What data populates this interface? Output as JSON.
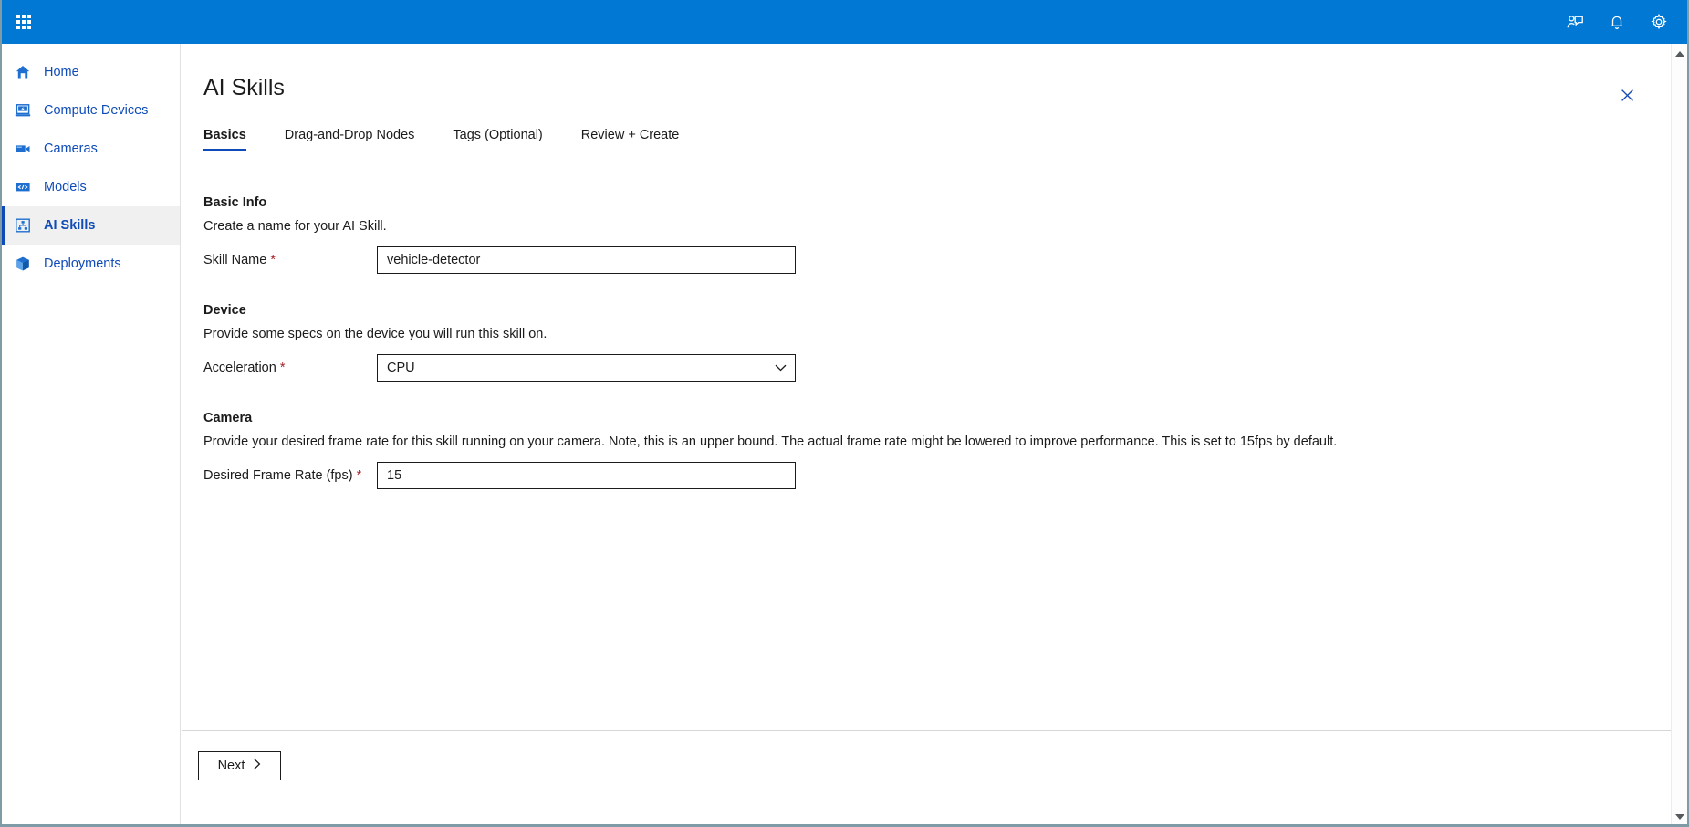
{
  "topbar": {
    "waffle_label": "app-launcher",
    "icons": [
      {
        "name": "feedback-icon",
        "title": "Feedback"
      },
      {
        "name": "notification-bell-icon",
        "title": "Notifications"
      },
      {
        "name": "settings-gear-icon",
        "title": "Settings"
      }
    ],
    "accent_color": "#0078d4"
  },
  "sidebar": {
    "items": [
      {
        "label": "Home",
        "icon": "home-icon",
        "active": false
      },
      {
        "label": "Compute Devices",
        "icon": "laptop-icon",
        "active": false
      },
      {
        "label": "Cameras",
        "icon": "video-camera-icon",
        "active": false
      },
      {
        "label": "Models",
        "icon": "code-brackets-icon",
        "active": false
      },
      {
        "label": "AI Skills",
        "icon": "skill-nodes-icon",
        "active": true
      },
      {
        "label": "Deployments",
        "icon": "cube-icon",
        "active": false
      }
    ],
    "link_color": "#0f4bb8",
    "active_bg": "#f0f0f0"
  },
  "panel": {
    "title": "AI Skills",
    "close_label": "Close",
    "tabs": [
      {
        "label": "Basics",
        "active": true
      },
      {
        "label": "Drag-and-Drop Nodes",
        "active": false
      },
      {
        "label": "Tags (Optional)",
        "active": false
      },
      {
        "label": "Review + Create",
        "active": false
      }
    ]
  },
  "sections": {
    "basic_info": {
      "title": "Basic Info",
      "description": "Create a name for your AI Skill.",
      "skill_name": {
        "label": "Skill Name",
        "required_marker": "*",
        "value": "vehicle-detector",
        "placeholder": ""
      }
    },
    "device": {
      "title": "Device",
      "description": "Provide some specs on the device you will run this skill on.",
      "acceleration": {
        "label": "Acceleration",
        "required_marker": "*",
        "value": "CPU",
        "options": [
          "CPU"
        ]
      }
    },
    "camera": {
      "title": "Camera",
      "description": "Provide your desired frame rate for this skill running on your camera. Note, this is an upper bound. The actual frame rate might be lowered to improve performance. This is set to 15fps by default.",
      "frame_rate": {
        "label": "Desired Frame Rate (fps)",
        "required_marker": "*",
        "value": "15",
        "placeholder": ""
      }
    }
  },
  "footer": {
    "next_label": "Next",
    "next_icon": "chevron-right-icon"
  },
  "scrollbar": {
    "up_icon": "scroll-up-arrow-icon",
    "down_icon": "scroll-down-arrow-icon"
  }
}
